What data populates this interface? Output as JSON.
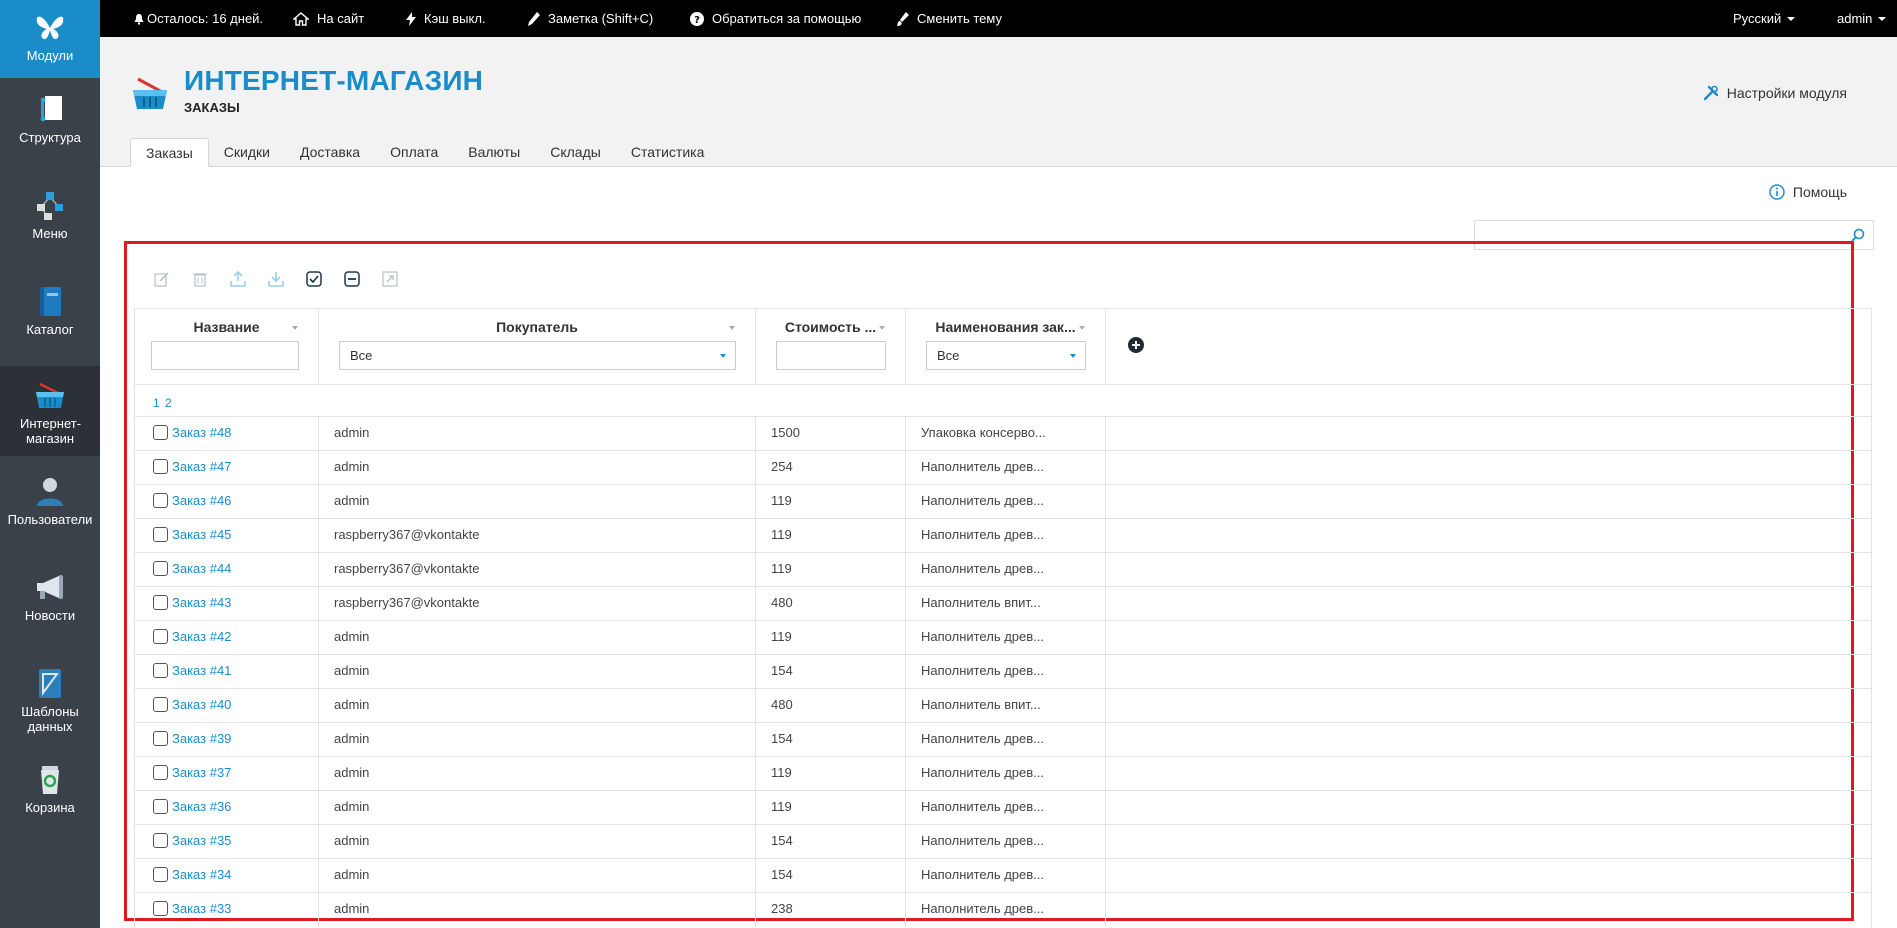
{
  "sidebar": {
    "items": [
      {
        "label": "Модули",
        "icon": "butterfly-icon"
      },
      {
        "label": "Структура",
        "icon": "structure-icon"
      },
      {
        "label": "Меню",
        "icon": "menu-tree-icon"
      },
      {
        "label": "Каталог",
        "icon": "catalog-book-icon"
      },
      {
        "label": "Интернет-магазин",
        "icon": "shop-basket-icon"
      },
      {
        "label": "Пользователи",
        "icon": "user-icon"
      },
      {
        "label": "Новости",
        "icon": "megaphone-icon"
      },
      {
        "label": "Шаблоны данных",
        "icon": "templates-icon"
      },
      {
        "label": "Корзина",
        "icon": "recycle-bin-icon"
      }
    ]
  },
  "topbar": {
    "days_left": "Осталось: 16 дней.",
    "to_site": "На сайт",
    "cache": "Кэш выкл.",
    "note": "Заметка (Shift+C)",
    "support": "Обратиться за помощью",
    "theme": "Сменить тему",
    "language": "Русский",
    "user": "admin"
  },
  "header": {
    "title": "ИНТЕРНЕТ-МАГАЗИН",
    "subtitle": "ЗАКАЗЫ",
    "settings": "Настройки модуля"
  },
  "tabs": [
    "Заказы",
    "Скидки",
    "Доставка",
    "Оплата",
    "Валюты",
    "Склады",
    "Статистика"
  ],
  "help": "Помощь",
  "search": {
    "placeholder": ""
  },
  "grid": {
    "columns": [
      "Название",
      "Покупатель",
      "Стоимость ...",
      "Наименования зак..."
    ],
    "buyer_filter": "Все",
    "items_filter": "Все",
    "pager": "1 2",
    "rows": [
      {
        "name": "Заказ #48",
        "buyer": "admin",
        "cost": "1500",
        "items": "Упаковка консерво..."
      },
      {
        "name": "Заказ #47",
        "buyer": "admin",
        "cost": "254",
        "items": "Наполнитель древ..."
      },
      {
        "name": "Заказ #46",
        "buyer": "admin",
        "cost": "119",
        "items": "Наполнитель древ..."
      },
      {
        "name": "Заказ #45",
        "buyer": "raspberry367@vkontakte",
        "cost": "119",
        "items": "Наполнитель древ..."
      },
      {
        "name": "Заказ #44",
        "buyer": "raspberry367@vkontakte",
        "cost": "119",
        "items": "Наполнитель древ..."
      },
      {
        "name": "Заказ #43",
        "buyer": "raspberry367@vkontakte",
        "cost": "480",
        "items": "Наполнитель впит..."
      },
      {
        "name": "Заказ #42",
        "buyer": "admin",
        "cost": "119",
        "items": "Наполнитель древ..."
      },
      {
        "name": "Заказ #41",
        "buyer": "admin",
        "cost": "154",
        "items": "Наполнитель древ..."
      },
      {
        "name": "Заказ #40",
        "buyer": "admin",
        "cost": "480",
        "items": "Наполнитель впит..."
      },
      {
        "name": "Заказ #39",
        "buyer": "admin",
        "cost": "154",
        "items": "Наполнитель древ..."
      },
      {
        "name": "Заказ #37",
        "buyer": "admin",
        "cost": "119",
        "items": "Наполнитель древ..."
      },
      {
        "name": "Заказ #36",
        "buyer": "admin",
        "cost": "119",
        "items": "Наполнитель древ..."
      },
      {
        "name": "Заказ #35",
        "buyer": "admin",
        "cost": "154",
        "items": "Наполнитель древ..."
      },
      {
        "name": "Заказ #34",
        "buyer": "admin",
        "cost": "154",
        "items": "Наполнитель древ..."
      },
      {
        "name": "Заказ #33",
        "buyer": "admin",
        "cost": "238",
        "items": "Наполнитель древ..."
      }
    ]
  },
  "colors": {
    "accent": "#1a8cc8",
    "sidebar": "#3a4149",
    "highlight": "#e0191f"
  }
}
